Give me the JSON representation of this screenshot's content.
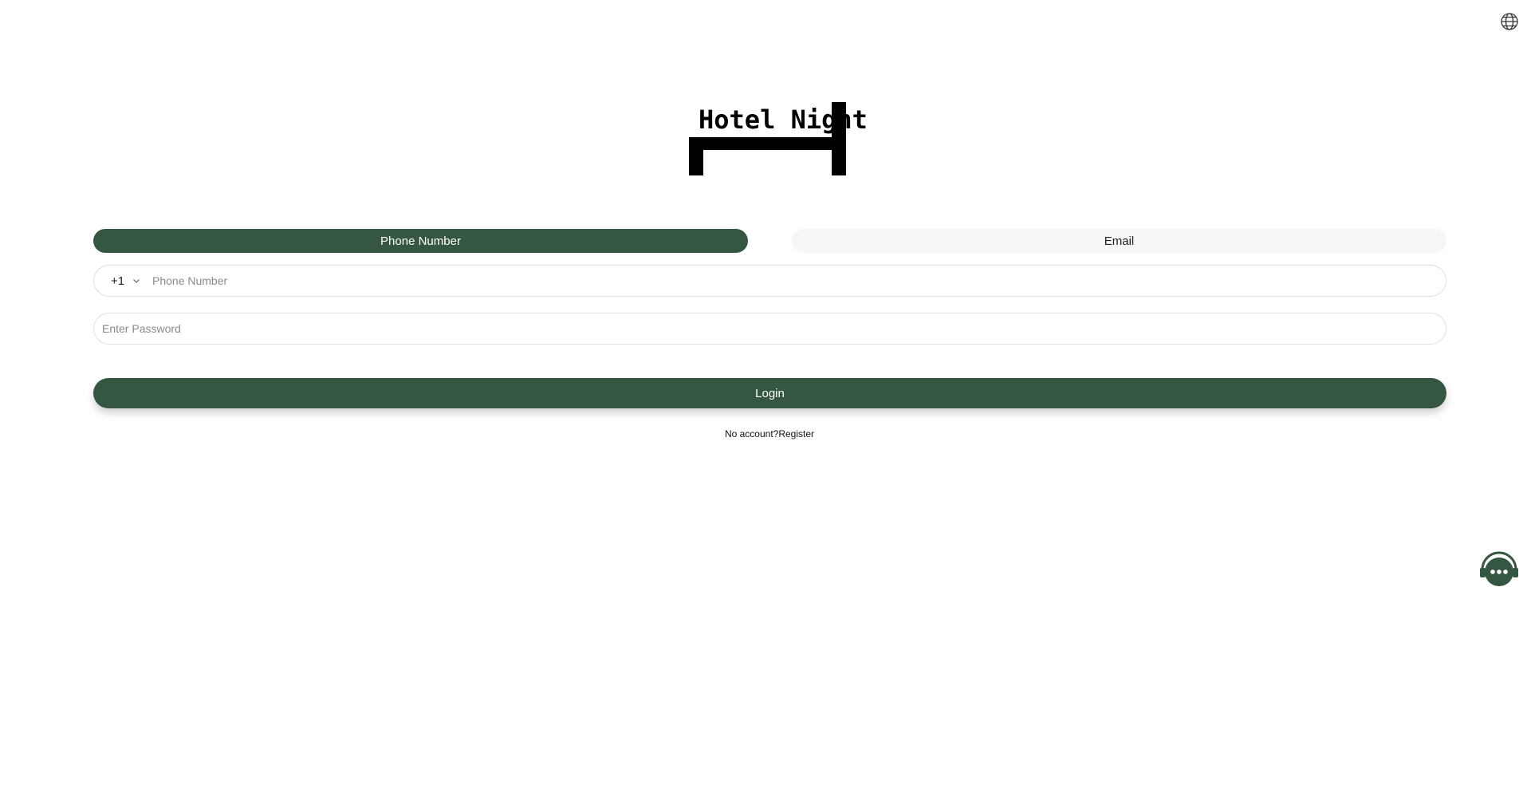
{
  "header": {
    "language_icon": "globe-icon"
  },
  "logo": {
    "text": "Hotel Night"
  },
  "tabs": [
    {
      "label": "Phone Number",
      "active": true
    },
    {
      "label": "Email",
      "active": false
    }
  ],
  "form": {
    "country_code": "+1",
    "phone_placeholder": "Phone Number",
    "password_placeholder": "Enter Password",
    "login_label": "Login"
  },
  "register": {
    "prompt": "No account?",
    "link": "Register"
  },
  "support": {
    "icon": "customer-support-icon"
  },
  "colors": {
    "accent": "#355640",
    "inactive_tab": "#f6f6f6",
    "border": "#e0e0e0"
  }
}
